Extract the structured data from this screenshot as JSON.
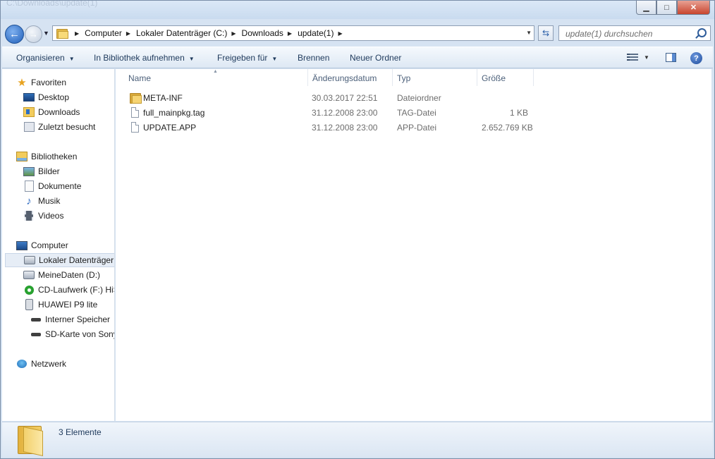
{
  "window": {
    "title": "C:\\Downloads\\update(1)",
    "caption_buttons": {
      "minimize": "▁",
      "maximize": "□",
      "close": "✕"
    }
  },
  "navigation": {
    "breadcrumbs": [
      "Computer",
      "Lokaler Datenträger (C:)",
      "Downloads",
      "update(1)"
    ],
    "search_placeholder": "update(1) durchsuchen"
  },
  "toolbar": {
    "organize": "Organisieren",
    "add_to_library": "In Bibliothek aufnehmen",
    "share_with": "Freigeben für",
    "burn": "Brennen",
    "new_folder": "Neuer Ordner"
  },
  "sidebar": {
    "favorites": "Favoriten",
    "desktop": "Desktop",
    "downloads": "Downloads",
    "recent": "Zuletzt besucht",
    "libraries": "Bibliotheken",
    "pictures": "Bilder",
    "documents": "Dokumente",
    "music": "Musik",
    "videos": "Videos",
    "computer": "Computer",
    "drive_c": "Lokaler Datenträger",
    "drive_d": "MeineDaten (D:)",
    "drive_f": "CD-Laufwerk (F:) HiSuite",
    "phone": "HUAWEI P9 lite",
    "internal_storage": "Interner Speicher",
    "sd_card": "SD-Karte von Sony",
    "network": "Netzwerk"
  },
  "file_list": {
    "columns": [
      "Name",
      "Änderungsdatum",
      "Typ",
      "Größe"
    ],
    "rows": [
      {
        "name": "META-INF",
        "date": "30.03.2017 22:51",
        "type": "Dateiordner",
        "size": "",
        "icon": "folder-icon"
      },
      {
        "name": "full_mainpkg.tag",
        "date": "31.12.2008 23:00",
        "type": "TAG-Datei",
        "size": "1 KB",
        "icon": "file-icon"
      },
      {
        "name": "UPDATE.APP",
        "date": "31.12.2008 23:00",
        "type": "APP-Datei",
        "size": "2.652.769 KB",
        "icon": "file-icon"
      }
    ]
  },
  "status": {
    "item_count": "3 Elemente"
  },
  "colors": {
    "accent": "#1e395b",
    "selection": "#e6edf6",
    "chrome": "#d6e3f2"
  }
}
